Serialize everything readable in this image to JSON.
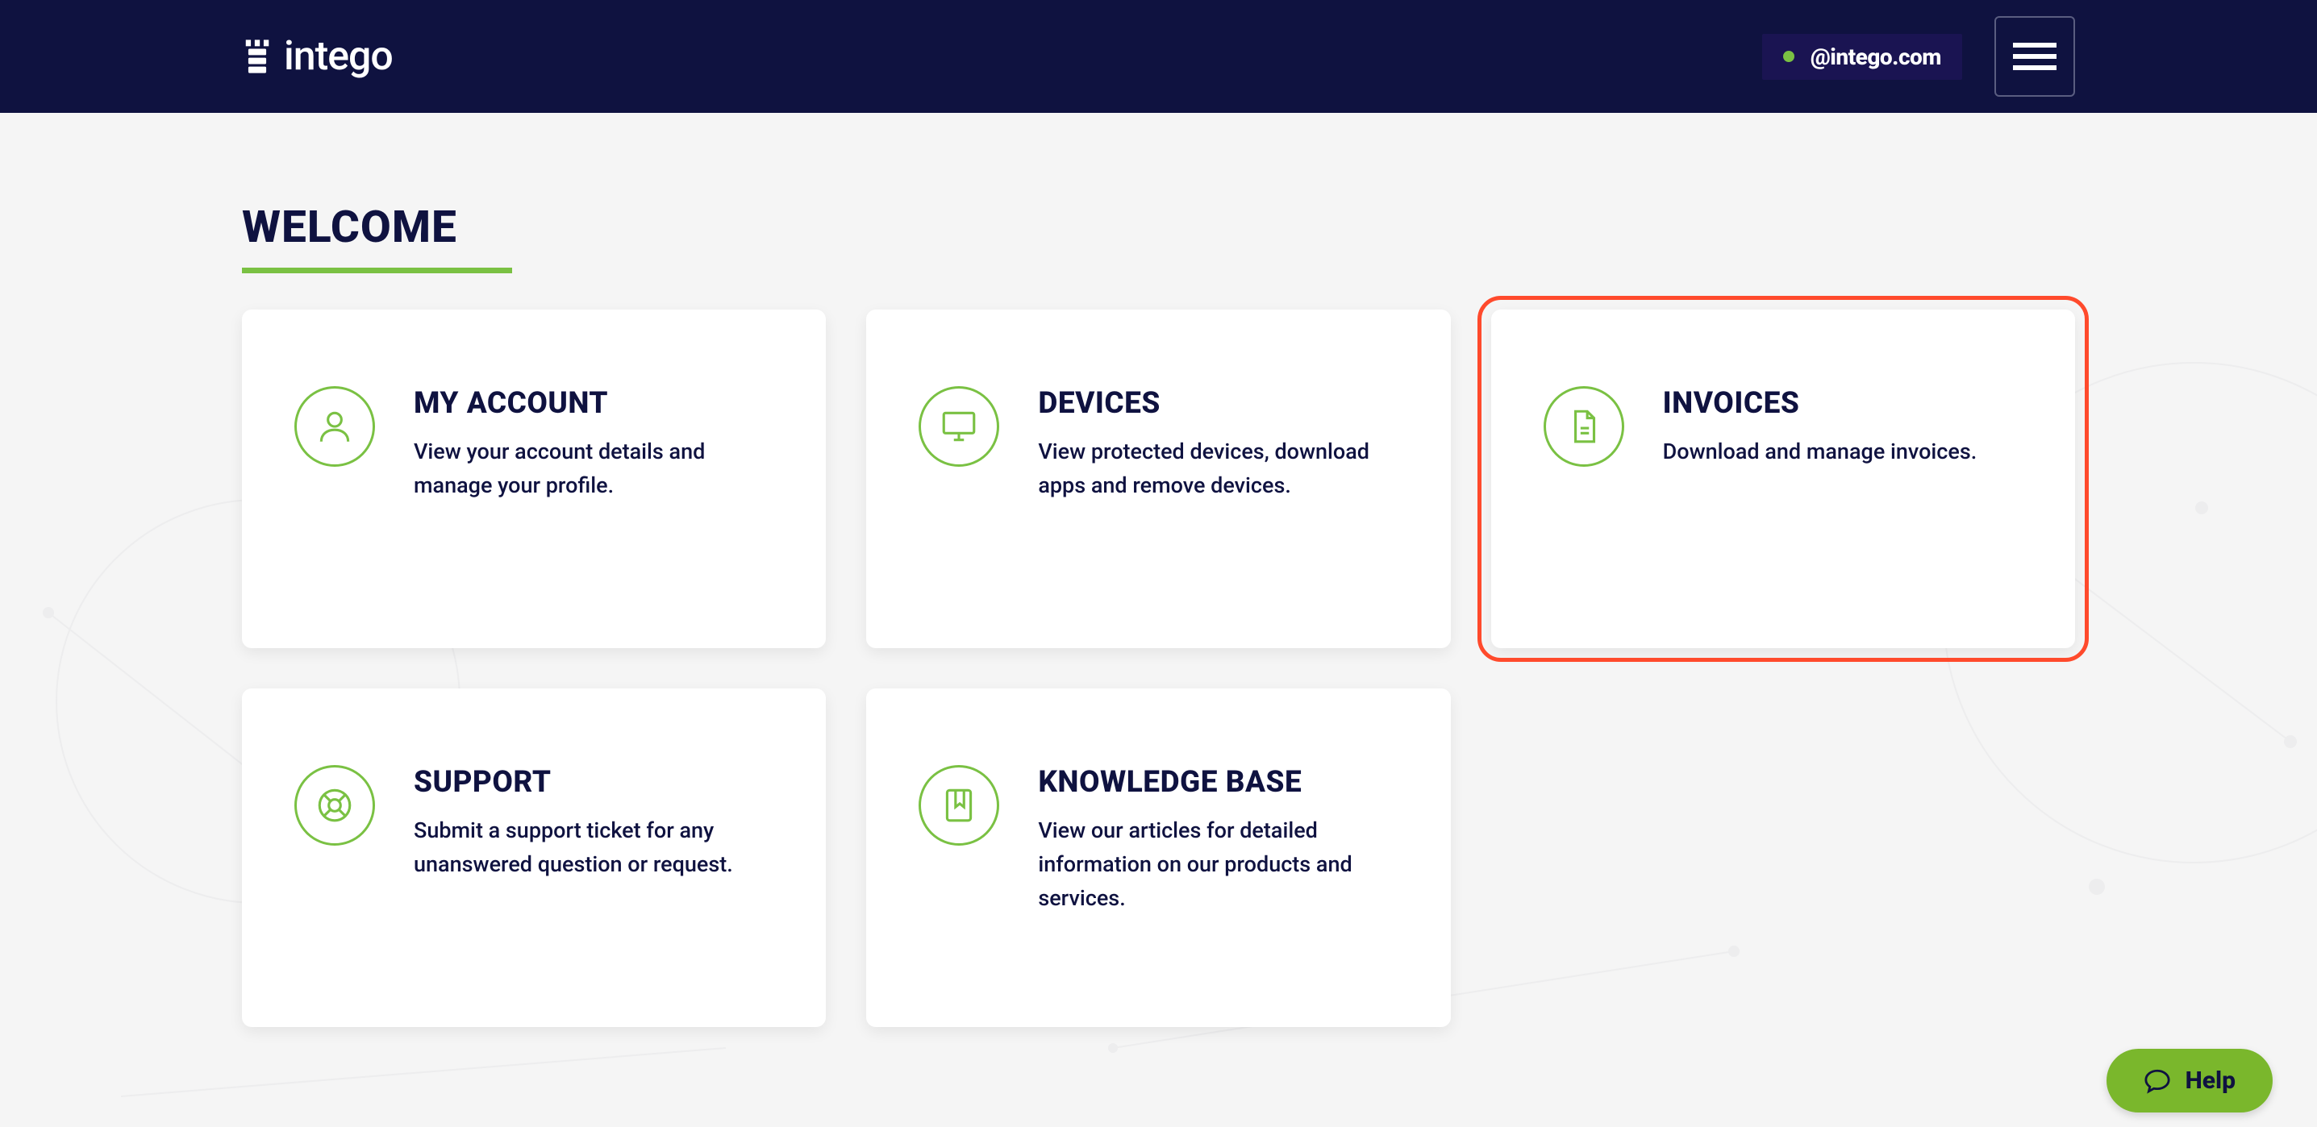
{
  "brand": "intego",
  "header": {
    "user_email": "@intego.com"
  },
  "page": {
    "title": "WELCOME"
  },
  "cards": {
    "my_account": {
      "title": "MY ACCOUNT",
      "desc": "View your account details and manage your profile."
    },
    "devices": {
      "title": "DEVICES",
      "desc": "View protected devices, download apps and remove devices."
    },
    "invoices": {
      "title": "INVOICES",
      "desc": "Download and manage invoices.",
      "highlighted": true
    },
    "support": {
      "title": "SUPPORT",
      "desc": "Submit a support ticket for any unanswered question or request."
    },
    "knowledge": {
      "title": "KNOWLEDGE BASE",
      "desc": "View our articles for detailed information on our products and services."
    }
  },
  "help_label": "Help"
}
